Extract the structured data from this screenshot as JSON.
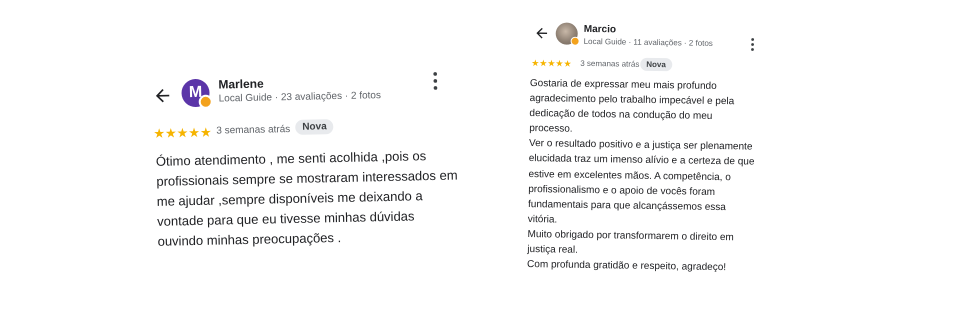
{
  "reviews": [
    {
      "name": "Marlene",
      "avatar_initial": "M",
      "meta": "Local Guide · 23 avaliações · 2 fotos",
      "stars": "★★★★★",
      "rating": 5,
      "time": "3 semanas atrás",
      "badge": "Nova",
      "text": "Ótimo atendimento , me senti acolhida ,pois os profissionais sempre se mostraram interessados em me ajudar ,sempre disponíveis me deixando a vontade para que eu tivesse minhas dúvidas ouvindo minhas preocupações ."
    },
    {
      "name": "Marcio",
      "meta": "Local Guide · 11 avaliações · 2 fotos",
      "stars": "★★★★★",
      "rating": 5,
      "time": "3 semanas atrás",
      "badge": "Nova",
      "paragraphs": [
        "Gostaria de expressar meu mais profundo agradecimento pelo trabalho impecável e pela dedicação de todos na condução do meu processo.",
        "Ver o resultado positivo e a justiça ser plenamente elucidada traz um imenso alívio e a certeza de que estive em excelentes mãos. A competência, o profissionalismo e o apoio de vocês foram fundamentais para que alcançássemos essa vitória.",
        "Muito obrigado por transformarem o direito em justiça real.",
        "Com profunda gratidão e respeito, agradeço!"
      ]
    }
  ],
  "colors": {
    "star": "#f6b400",
    "avatar_marlene": "#5b35a8",
    "guide_badge": "#f3a21d",
    "chip_bg": "#e8eaed",
    "meta_text": "#5f6368"
  },
  "icons": {
    "back": "arrow-back-icon",
    "more": "more-vert-icon",
    "star": "star-icon",
    "guide": "local-guide-badge-icon"
  }
}
